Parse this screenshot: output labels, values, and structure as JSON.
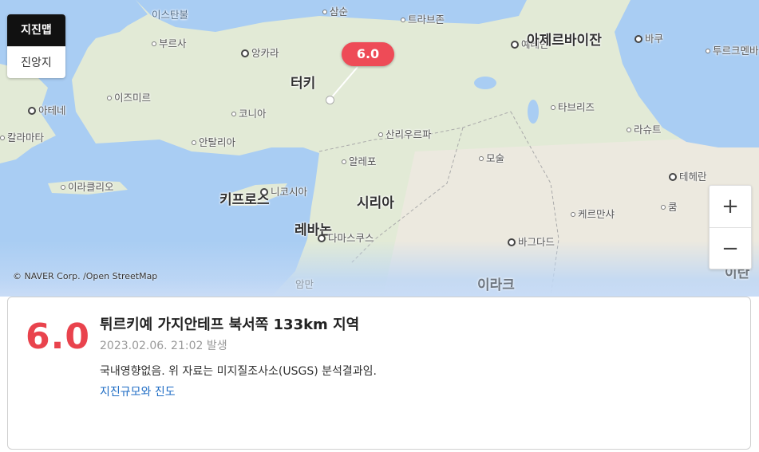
{
  "map": {
    "toggle": {
      "active_label": "지진맵",
      "inactive_label": "진앙지"
    },
    "zoom": {
      "in_label": "+",
      "out_label": "−"
    },
    "magnitude_bubble": "6.0",
    "copyright": "© NAVER Corp. /Open StreetMap",
    "places": {
      "istanbul": "이스탄불",
      "samsun": "삼순",
      "trabzon": "트라브존",
      "bursa": "부르사",
      "ankara": "앙카라",
      "yerevan": "예레반",
      "azerbaijan": "아제르바이잔",
      "baku": "바쿠",
      "turkmenbashi": "투르크멘바",
      "turkiye": "터키",
      "izmir": "이즈미르",
      "athens": "아테네",
      "konya": "코니아",
      "tabriz": "타브리즈",
      "kalamata": "칼라마타",
      "antalya": "안탈리아",
      "sanliurfa": "산리우르파",
      "rasht": "라슈트",
      "aleppo": "알레포",
      "mosul": "모술",
      "tehran": "테헤란",
      "iraklio": "이라클리오",
      "cyprus": "키프로스",
      "nicosia": "니코시아",
      "syria": "시리아",
      "qom": "쿰",
      "kermanshah": "케르만샤",
      "lebanon": "레바논",
      "damascus": "다마스쿠스",
      "baghdad": "바그다드",
      "iraq": "이라크",
      "iran": "이란",
      "amman": "암만"
    }
  },
  "card": {
    "magnitude": "6.0",
    "location": "튀르키예 가지안테프 북서쪽 133km 지역",
    "time": "2023.02.06. 21:02 발생",
    "note": "국내영향없음. 위 자료는 미지질조사소(USGS) 분석결과임.",
    "link": "지진규모와 진도"
  },
  "colors": {
    "accent": "#e9434d",
    "bubble": "#ee4b57",
    "link": "#1c6bc4",
    "sea": "#a9cdf3",
    "land": "#e3ebd8"
  }
}
